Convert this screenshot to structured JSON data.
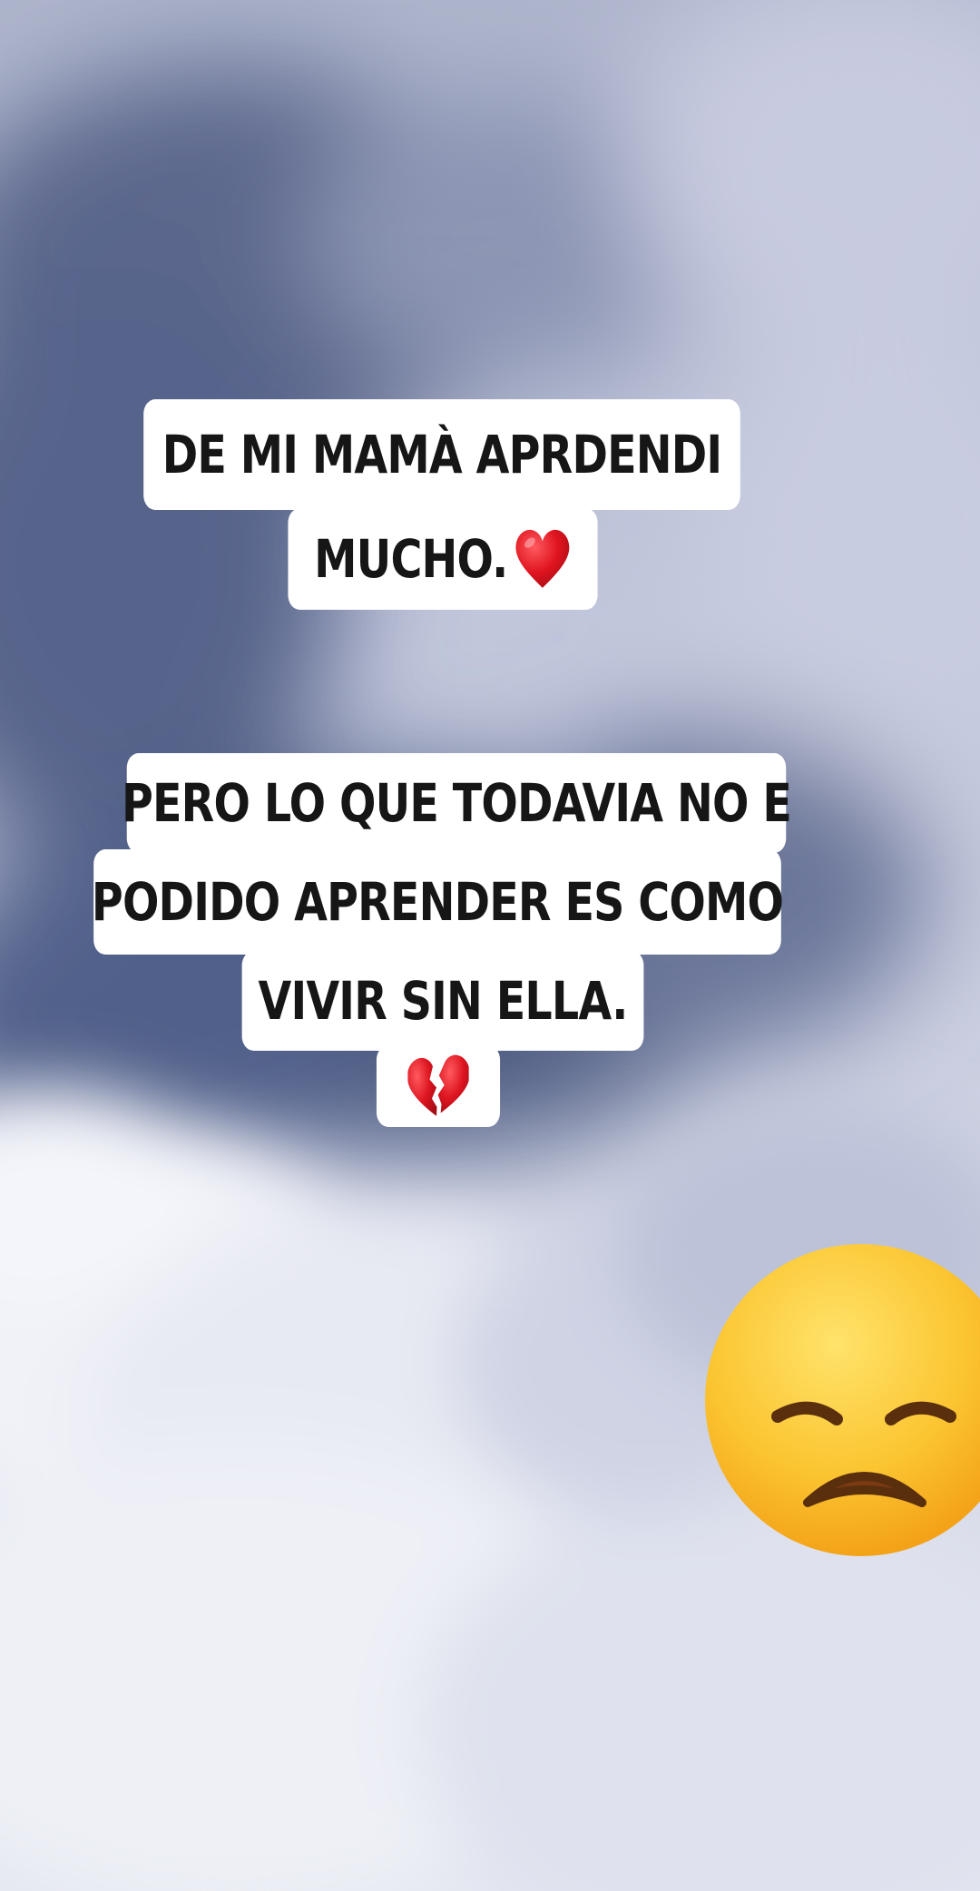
{
  "caption_1": {
    "line_1": "De mi mamà aprdendi",
    "line_2": "mucho.",
    "emoji": "red-heart-icon"
  },
  "caption_2": {
    "line_1": "Pero lo que todavia no e",
    "line_2": "podido aprender es como",
    "line_3": "vivir sin ella.",
    "emoji": "broken-heart-icon"
  },
  "sticker": {
    "emoji": "disappointed-face-icon"
  },
  "colors": {
    "sky_light": "#e9ebf4",
    "sky_mid": "#b9bfd6",
    "cloud_dark": "#4f5c80",
    "caption_bg": "#ffffff",
    "caption_text": "#161616",
    "heart_red": "#d7141f",
    "emoji_yellow": "#f7b91d"
  }
}
